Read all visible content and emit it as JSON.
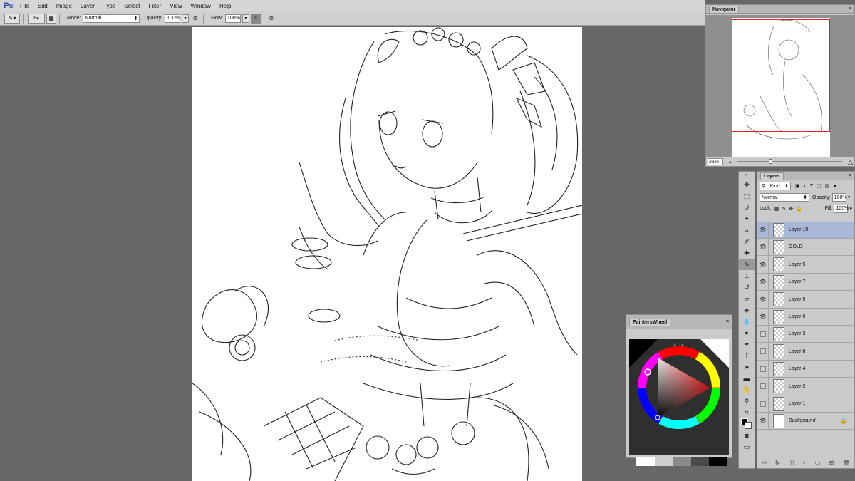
{
  "app": {
    "logo": "Ps"
  },
  "menu": [
    "File",
    "Edit",
    "Image",
    "Layer",
    "Type",
    "Select",
    "Filter",
    "View",
    "Window",
    "Help"
  ],
  "options": {
    "brush_size": "8",
    "mode_label": "Mode:",
    "mode_value": "Normal",
    "opacity_label": "Opacity:",
    "opacity_value": "100%",
    "flow_label": "Flow:",
    "flow_value": "100%"
  },
  "navigator": {
    "title": "Navigator",
    "zoom": "25%"
  },
  "painters_wheel": {
    "title": "PaintersWheel",
    "swatches": [
      "#ffffff",
      "#cfcfcf",
      "#8a8a8a",
      "#4a4a4a",
      "#000000"
    ]
  },
  "layers_panel": {
    "title": "Layers",
    "filter": "Kind",
    "blend_mode": "Normal",
    "opacity_label": "Opacity:",
    "opacity_value": "100%",
    "lock_label": "Lock:",
    "fill_label": "Fill:",
    "fill_value": "100%",
    "layers": [
      {
        "name": "Layer 10",
        "visible": true,
        "selected": true
      },
      {
        "name": "GOLD",
        "visible": true,
        "selected": false
      },
      {
        "name": "Layer 5",
        "visible": true,
        "selected": false
      },
      {
        "name": "Layer 7",
        "visible": true,
        "selected": false
      },
      {
        "name": "Layer 9",
        "visible": true,
        "selected": false
      },
      {
        "name": "Layer 6",
        "visible": true,
        "selected": false
      },
      {
        "name": "Layer 3",
        "visible": false,
        "selected": false
      },
      {
        "name": "Layer 8",
        "visible": false,
        "selected": false
      },
      {
        "name": "Layer 4",
        "visible": false,
        "selected": false
      },
      {
        "name": "Layer 2",
        "visible": false,
        "selected": false
      },
      {
        "name": "Layer 1",
        "visible": false,
        "selected": false
      },
      {
        "name": "Background",
        "visible": true,
        "selected": false,
        "locked": true
      }
    ]
  },
  "colors": {
    "workspace": "#676767",
    "panel": "#cacaca",
    "selection": "#a8b6d8",
    "nav_rect": "#e02020"
  }
}
